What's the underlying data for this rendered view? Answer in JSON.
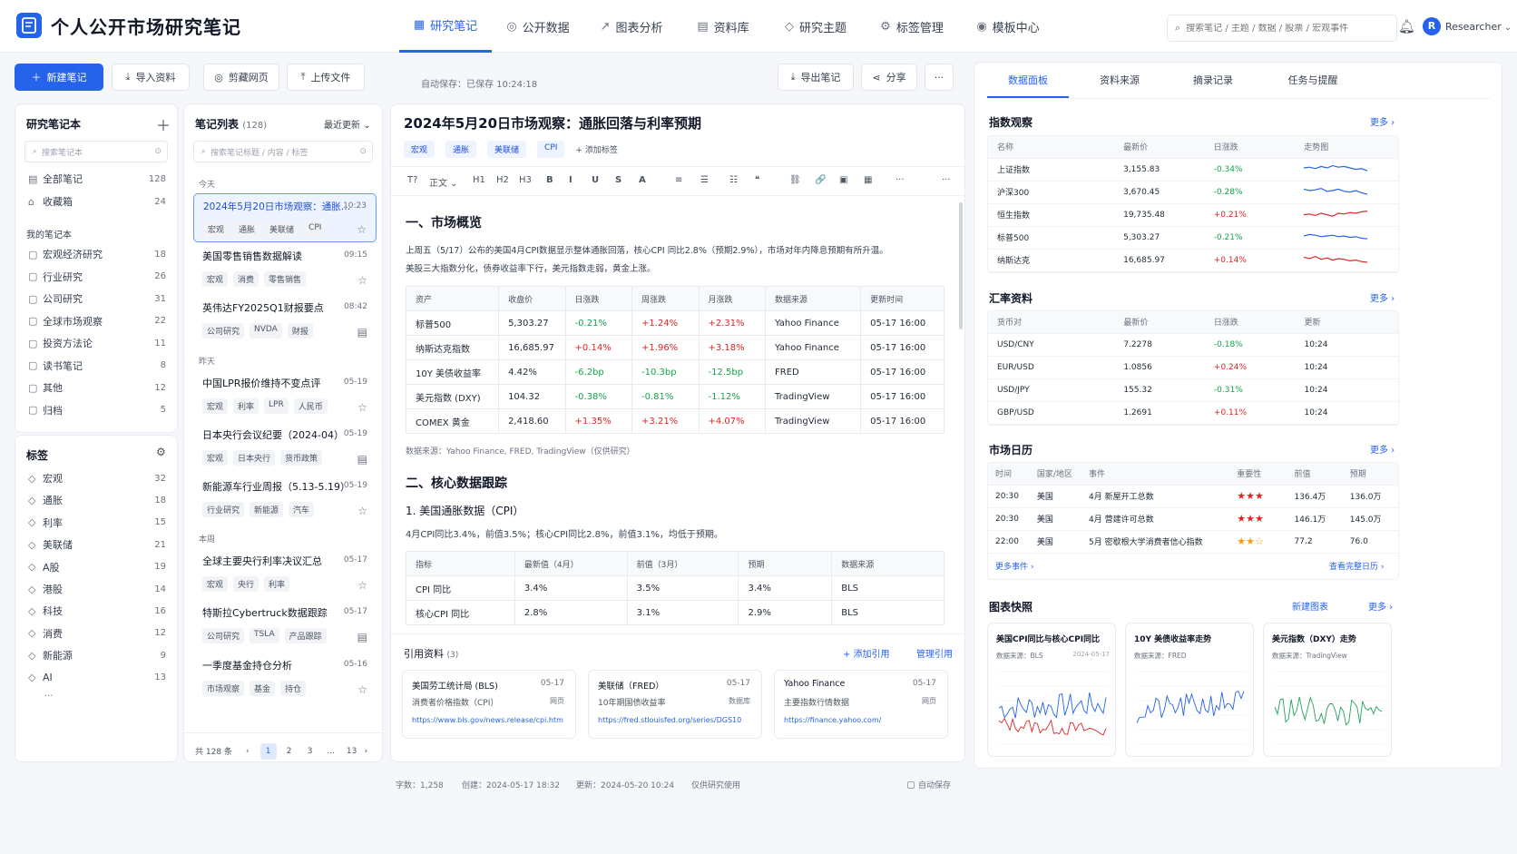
{
  "app": {
    "title": "个人公开市场研究笔记",
    "user": "Researcher",
    "avatar_letter": "R"
  },
  "nav": [
    {
      "label": "研究笔记",
      "icon": "grid-icon",
      "glyph": "▦"
    },
    {
      "label": "公开数据",
      "icon": "database-icon",
      "glyph": "◎"
    },
    {
      "label": "图表分析",
      "icon": "chart-icon",
      "glyph": "↗"
    },
    {
      "label": "资料库",
      "icon": "document-icon",
      "glyph": "▤"
    },
    {
      "label": "研究主题",
      "icon": "shield-icon",
      "glyph": "◇"
    },
    {
      "label": "标签管理",
      "icon": "gear-icon",
      "glyph": "⚙"
    },
    {
      "label": "模板中心",
      "icon": "template-icon",
      "glyph": "◉"
    }
  ],
  "search": {
    "placeholder": "搜索笔记 / 主题 / 数据 / 股票 / 宏观事件"
  },
  "toolbar": {
    "new_note": "新建笔记",
    "import": "导入资料",
    "clip": "剪藏网页",
    "upload": "上传文件",
    "autosave": "自动保存：已保存 10:24:18",
    "export": "导出笔记",
    "share": "分享",
    "more": "···"
  },
  "sidebar": {
    "notebooks_title": "研究笔记本",
    "search_placeholder": "搜索笔记本",
    "top_items": [
      {
        "label": "全部笔记",
        "count": "128"
      },
      {
        "label": "收藏箱",
        "count": "24"
      }
    ],
    "my_title": "我的笔记本",
    "my_items": [
      {
        "label": "宏观经济研究",
        "count": "18"
      },
      {
        "label": "行业研究",
        "count": "26"
      },
      {
        "label": "公司研究",
        "count": "31"
      },
      {
        "label": "全球市场观察",
        "count": "22"
      },
      {
        "label": "投资方法论",
        "count": "11"
      },
      {
        "label": "读书笔记",
        "count": "8"
      },
      {
        "label": "其他",
        "count": "12"
      },
      {
        "label": "归档",
        "count": "5"
      }
    ],
    "tags_title": "标签",
    "tags": [
      {
        "label": "宏观",
        "count": "32"
      },
      {
        "label": "通胀",
        "count": "18"
      },
      {
        "label": "利率",
        "count": "15"
      },
      {
        "label": "美联储",
        "count": "21"
      },
      {
        "label": "A股",
        "count": "19"
      },
      {
        "label": "港股",
        "count": "14"
      },
      {
        "label": "科技",
        "count": "16"
      },
      {
        "label": "消费",
        "count": "12"
      },
      {
        "label": "新能源",
        "count": "9"
      },
      {
        "label": "AI",
        "count": "13"
      }
    ],
    "tags_more": "···"
  },
  "notes": {
    "title": "笔记列表",
    "count": "(128)",
    "sort": "最近更新",
    "search_placeholder": "搜索笔记标题 / 内容 / 标签",
    "groups": [
      "今天",
      "昨天",
      "本周"
    ],
    "items": [
      {
        "title": "2024年5月20日市场观察：通胀回落与利率预期",
        "time": "10:23",
        "tags": [
          "宏观",
          "通胀",
          "美联储",
          "CPI"
        ],
        "icon": "star-icon",
        "glyph": "☆"
      },
      {
        "title": "美国零售销售数据解读",
        "time": "09:15",
        "tags": [
          "宏观",
          "消费",
          "零售销售"
        ],
        "icon": "star-icon",
        "glyph": "☆"
      },
      {
        "title": "英伟达FY2025Q1财报要点",
        "time": "08:42",
        "tags": [
          "公司研究",
          "NVDA",
          "财报"
        ],
        "icon": "document-icon",
        "glyph": "▤"
      },
      {
        "title": "中国LPR报价维持不变点评",
        "time": "05-19",
        "tags": [
          "宏观",
          "利率",
          "LPR",
          "人民币"
        ],
        "icon": "star-icon",
        "glyph": "☆"
      },
      {
        "title": "日本央行会议纪要（2024-04）",
        "time": "05-19",
        "tags": [
          "宏观",
          "日本央行",
          "货币政策"
        ],
        "icon": "document-icon",
        "glyph": "▤"
      },
      {
        "title": "新能源车行业周报（5.13-5.19）",
        "time": "05-19",
        "tags": [
          "行业研究",
          "新能源",
          "汽车"
        ],
        "icon": "star-icon",
        "glyph": "☆"
      },
      {
        "title": "全球主要央行利率决议汇总",
        "time": "05-17",
        "tags": [
          "宏观",
          "央行",
          "利率"
        ],
        "icon": "star-icon",
        "glyph": "☆"
      },
      {
        "title": "特斯拉Cybertruck数据跟踪",
        "time": "05-17",
        "tags": [
          "公司研究",
          "TSLA",
          "产品跟踪"
        ],
        "icon": "document-icon",
        "glyph": "▤"
      },
      {
        "title": "一季度基金持仓分析",
        "time": "05-16",
        "tags": [
          "市场观察",
          "基金",
          "持仓"
        ],
        "icon": "star-icon",
        "glyph": "☆"
      }
    ],
    "pager": {
      "total": "共 128 条",
      "pages": [
        "1",
        "2",
        "3",
        "...",
        "13"
      ]
    }
  },
  "editor": {
    "title": "2024年5月20日市场观察：通胀回落与利率预期",
    "tags": [
      "宏观",
      "通胀",
      "美联储",
      "CPI"
    ],
    "add_tag": "+ 添加标签",
    "fmt": [
      "T?",
      "正文 ⌄",
      "H1",
      "H2",
      "H3",
      "B",
      "I",
      "U",
      "S",
      "A",
      "≡",
      "☰",
      "☷",
      "❝",
      "⛓",
      "🔗",
      "▣",
      "▦",
      "···",
      "···"
    ],
    "h1": "一、市场概览",
    "p1": "上周五（5/17）公布的美国4月CPI数据显示整体通胀回落，核心CPI 同比2.8%（预期2.9%），市场对年内降息预期有所升温。",
    "p2": "美股三大指数分化，债券收益率下行，美元指数走弱，黄金上涨。",
    "t1_head": [
      "资产",
      "收盘价",
      "日涨跌",
      "周涨跌",
      "月涨跌",
      "数据来源",
      "更新时间"
    ],
    "t1_rows": [
      [
        "标普500",
        "5,303.27",
        "-0.21%",
        "+1.24%",
        "+2.31%",
        "Yahoo Finance",
        "05-17 16:00"
      ],
      [
        "纳斯达克指数",
        "16,685.97",
        "+0.14%",
        "+1.96%",
        "+3.18%",
        "Yahoo Finance",
        "05-17 16:00"
      ],
      [
        "10Y 美债收益率",
        "4.42%",
        "-6.2bp",
        "-10.3bp",
        "-12.5bp",
        "FRED",
        "05-17 16:00"
      ],
      [
        "美元指数 (DXY)",
        "104.32",
        "-0.38%",
        "-0.81%",
        "-1.12%",
        "TradingView",
        "05-17 16:00"
      ],
      [
        "COMEX 黄金",
        "2,418.60",
        "+1.35%",
        "+3.21%",
        "+4.07%",
        "TradingView",
        "05-17 16:00"
      ]
    ],
    "t1_source": "数据来源：Yahoo Finance, FRED, TradingView（仅供研究）",
    "h2": "二、核心数据跟踪",
    "h3": "1. 美国通胀数据（CPI）",
    "p3": "4月CPI同比3.4%，前值3.5%；核心CPI同比2.8%，前值3.1%，均低于预期。",
    "t2_head": [
      "指标",
      "最新值（4月）",
      "前值（3月）",
      "预期",
      "数据来源"
    ],
    "t2_rows": [
      [
        "CPI 同比",
        "3.4%",
        "3.5%",
        "3.4%",
        "BLS"
      ],
      [
        "核心CPI 同比",
        "2.8%",
        "3.1%",
        "2.9%",
        "BLS"
      ]
    ],
    "refs_title": "引用资料",
    "refs_count": "(3)",
    "refs_add": "+ 添加引用",
    "refs_manage": "管理引用",
    "refs": [
      {
        "name": "美国劳工统计局 (BLS)",
        "date": "05-17",
        "desc": "消费者价格指数（CPI）",
        "type": "网页",
        "url": "https://www.bls.gov/news.release/cpi.htm"
      },
      {
        "name": "美联储（FRED）",
        "date": "05-17",
        "desc": "10年期国债收益率",
        "type": "数据库",
        "url": "https://fred.stlouisfed.org/series/DGS10"
      },
      {
        "name": "Yahoo Finance",
        "date": "05-17",
        "desc": "主要指数行情数据",
        "type": "网页",
        "url": "https://finance.yahoo.com/"
      }
    ],
    "status": {
      "words": "字数：1,258",
      "created": "创建：2024-05-17 18:32",
      "updated": "更新：2024-05-20 10:24",
      "usage": "仅供研究使用",
      "autosave": "自动保存"
    }
  },
  "right": {
    "tabs": [
      "数据面板",
      "资料来源",
      "摘录记录",
      "任务与提醒"
    ],
    "more": "更多 ›",
    "idx_title": "指数观察",
    "idx_head": [
      "名称",
      "最新价",
      "日涨跌",
      "走势图"
    ],
    "idx_rows": [
      {
        "name": "上证指数",
        "price": "3,155.83",
        "chg": "-0.34%",
        "trend": [
          0.5,
          0.45,
          0.55,
          0.4,
          0.5,
          0.35,
          0.45,
          0.4,
          0.5,
          0.6,
          0.55,
          0.7
        ]
      },
      {
        "name": "沪深300",
        "price": "3,670.45",
        "chg": "-0.28%",
        "trend": [
          0.4,
          0.5,
          0.45,
          0.35,
          0.55,
          0.5,
          0.4,
          0.55,
          0.6,
          0.5,
          0.65,
          0.75
        ]
      },
      {
        "name": "恒生指数",
        "price": "19,735.48",
        "chg": "+0.21%",
        "trend": [
          0.6,
          0.55,
          0.65,
          0.5,
          0.6,
          0.7,
          0.5,
          0.55,
          0.45,
          0.5,
          0.4,
          0.35
        ]
      },
      {
        "name": "标普500",
        "price": "5,303.27",
        "chg": "-0.21%",
        "trend": [
          0.5,
          0.4,
          0.45,
          0.55,
          0.5,
          0.45,
          0.55,
          0.5,
          0.6,
          0.55,
          0.65,
          0.7
        ]
      },
      {
        "name": "纳斯达克",
        "price": "16,685.97",
        "chg": "+0.14%",
        "trend": [
          0.4,
          0.5,
          0.35,
          0.55,
          0.45,
          0.6,
          0.5,
          0.55,
          0.65,
          0.6,
          0.7,
          0.75
        ]
      }
    ],
    "fx_title": "汇率资料",
    "fx_head": [
      "货币对",
      "最新价",
      "日涨跌",
      "更新"
    ],
    "fx_rows": [
      [
        "USD/CNY",
        "7.2278",
        "-0.18%",
        "10:24"
      ],
      [
        "EUR/USD",
        "1.0856",
        "+0.24%",
        "10:24"
      ],
      [
        "USD/JPY",
        "155.32",
        "-0.31%",
        "10:24"
      ],
      [
        "GBP/USD",
        "1.2691",
        "+0.11%",
        "10:24"
      ]
    ],
    "cal_title": "市场日历",
    "cal_head": [
      "时间",
      "国家/地区",
      "事件",
      "重要性",
      "前值",
      "预期"
    ],
    "cal_rows": [
      [
        "20:30",
        "美国",
        "4月 新屋开工总数",
        "★★★",
        "136.4万",
        "136.0万"
      ],
      [
        "20:30",
        "美国",
        "4月 营建许可总数",
        "★★★",
        "146.1万",
        "145.0万"
      ],
      [
        "22:00",
        "美国",
        "5月 密歇根大学消费者信心指数",
        "★★☆",
        "77.2",
        "76.0"
      ]
    ],
    "cal_more": "更多事件 ›",
    "cal_full": "查看完整日历 ›",
    "charts_title": "图表快照",
    "charts_new": "新建图表",
    "charts": [
      {
        "title": "美国CPI同比与核心CPI同比",
        "src": "数据来源：BLS",
        "date": "2024-05-17"
      },
      {
        "title": "10Y 美债收益率走势",
        "src": "数据来源：FRED",
        "date": ""
      },
      {
        "title": "美元指数（DXY）走势",
        "src": "数据来源：TradingView",
        "date": ""
      }
    ]
  },
  "colors": {
    "accent": "#2563eb",
    "up": "#dc2626",
    "down": "#16a34a"
  }
}
